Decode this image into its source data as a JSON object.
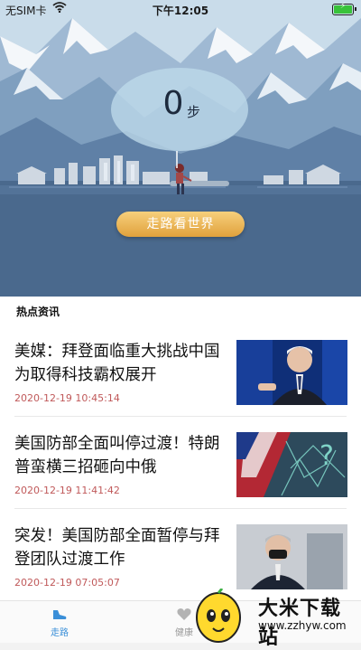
{
  "status_bar": {
    "carrier": "无SIM卡",
    "time": "下午12:05",
    "wifi_icon": "wifi-icon",
    "battery_icon": "battery-charging-icon"
  },
  "hero": {
    "steps": "0",
    "steps_unit": "步",
    "button_label": "走路看世界"
  },
  "news": {
    "section_title": "热点资讯",
    "items": [
      {
        "headline": "美媒：拜登面临重大挑战中国为取得科技霸权展开",
        "time": "2020-12-19 10:45:14"
      },
      {
        "headline": "美国防部全面叫停过渡！特朗普蛮横三招砸向中俄",
        "time": "2020-12-19 11:41:42"
      },
      {
        "headline": "突发！美国防部全面暂停与拜登团队过渡工作",
        "time": "2020-12-19 07:05:07"
      }
    ]
  },
  "tabbar": {
    "tabs": [
      {
        "label": "走路",
        "icon": "shoe-icon",
        "active": true
      },
      {
        "label": "健康",
        "icon": "health-icon",
        "active": false
      }
    ]
  },
  "watermark": {
    "name": "大米下载站",
    "url": "www.zzhyw.com"
  },
  "colors": {
    "accent": "#3a8fd8",
    "button": "#e9b04f",
    "timestamp": "#c0595a"
  }
}
